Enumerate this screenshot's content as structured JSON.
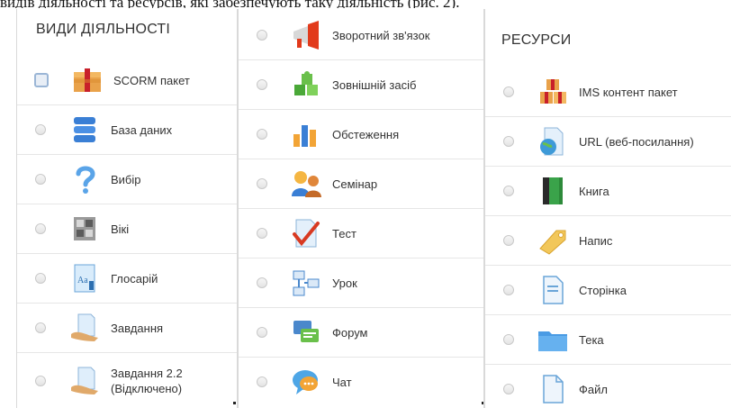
{
  "caption": "видів діяльності та ресурсів, які забезпечують таку діяльність (рис. 2).",
  "activities_panel": {
    "title": "ВИДИ ДІЯЛЬНОСТІ",
    "items": [
      {
        "label": "SCORM пакет",
        "icon": "scorm-package-icon",
        "selected": true
      },
      {
        "label": "База даних",
        "icon": "database-icon",
        "selected": false
      },
      {
        "label": "Вибір",
        "icon": "choice-question-icon",
        "selected": false
      },
      {
        "label": "Вікі",
        "icon": "wiki-icon",
        "selected": false
      },
      {
        "label": "Глосарій",
        "icon": "glossary-icon",
        "selected": false
      },
      {
        "label": "Завдання",
        "icon": "assignment-icon",
        "selected": false
      },
      {
        "label": "Завдання 2.2 (Відключено)",
        "icon": "assignment-disabled-icon",
        "selected": false
      }
    ]
  },
  "activities_panel_2": {
    "items": [
      {
        "label": "Зворотний зв'язок",
        "icon": "feedback-megaphone-icon"
      },
      {
        "label": "Зовнішній засіб",
        "icon": "external-tool-puzzle-icon"
      },
      {
        "label": "Обстеження",
        "icon": "survey-chart-icon"
      },
      {
        "label": "Семінар",
        "icon": "workshop-people-icon"
      },
      {
        "label": "Тест",
        "icon": "quiz-check-icon"
      },
      {
        "label": "Урок",
        "icon": "lesson-flow-icon"
      },
      {
        "label": "Форум",
        "icon": "forum-chat-icon"
      },
      {
        "label": "Чат",
        "icon": "chat-bubble-icon"
      }
    ]
  },
  "resources_panel": {
    "title": "РЕСУРСИ",
    "items": [
      {
        "label": "IMS контент пакет",
        "icon": "ims-package-icon"
      },
      {
        "label": "URL (веб-посилання)",
        "icon": "url-globe-icon"
      },
      {
        "label": "Книга",
        "icon": "book-icon"
      },
      {
        "label": "Напис",
        "icon": "label-tag-icon"
      },
      {
        "label": "Сторінка",
        "icon": "page-icon"
      },
      {
        "label": "Тека",
        "icon": "folder-icon"
      },
      {
        "label": "Файл",
        "icon": "file-icon"
      }
    ]
  }
}
